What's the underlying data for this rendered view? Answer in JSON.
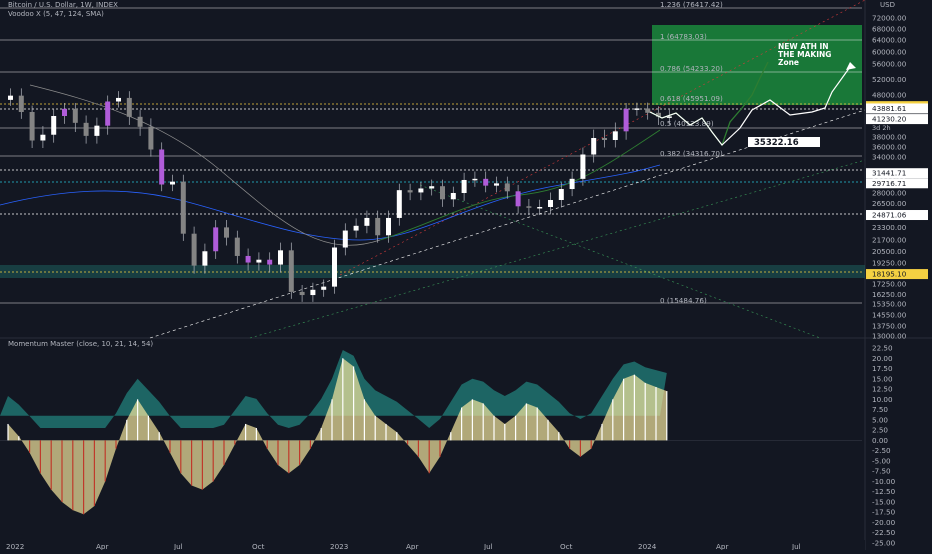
{
  "header": {
    "symbol_title": "Bitcoin / U.S. Dollar, 1W, INDEX",
    "indicator_1": "Voodoo X (5, 47, 124, SMA)",
    "indicator_2": "Momentum Master (close, 10, 21, 14, 54)",
    "currency": "USD"
  },
  "colors": {
    "background": "#131722",
    "up_candle": "#ffffff",
    "down_candle": "#848484",
    "accent_purple": "#b05cd9",
    "fib_box_green": "#1b8a3c",
    "support_band_teal": "#1e8f8a",
    "momentum_green": "#26a69a",
    "momentum_red": "#9b3b3b",
    "wave_yellow": "#f5e79e"
  },
  "chart_data": [
    {
      "type": "candlestick",
      "title": "Bitcoin / U.S. Dollar, 1W, INDEX",
      "x_tick_labels": [
        "2022",
        "Apr",
        "Jul",
        "Oct",
        "2023",
        "Apr",
        "Jul",
        "Oct",
        "2024",
        "Apr",
        "Jul"
      ],
      "y_tick_labels": [
        "72000.00",
        "68000.00",
        "64000.00",
        "60000.00",
        "56000.00",
        "52000.00",
        "48000.00",
        "44000.00",
        "41000.00",
        "38000.00",
        "36000.00",
        "34000.00",
        "31000.00",
        "28000.00",
        "26500.00",
        "25000.00",
        "23300.00",
        "21700.00",
        "20500.00",
        "19250.00",
        "17250.00",
        "15350.00",
        "16250.00",
        "14550.00",
        "13750.00",
        "13000.00"
      ],
      "series": [
        {
          "values": [
            47800,
            43000,
            37300,
            38400,
            42000,
            43800,
            40500,
            38200,
            40000,
            46000,
            47100,
            41800,
            39800,
            35500,
            29500,
            30000,
            22500,
            19000,
            20500,
            23300,
            22000,
            20000,
            19300,
            19600,
            19100,
            20600,
            16500,
            16200,
            16700,
            17000,
            20900,
            22900,
            23500,
            24500,
            22300,
            24500,
            28500,
            28100,
            28800,
            29200,
            27100,
            28000,
            30300,
            30500,
            29300,
            29700,
            28300,
            26100,
            25900,
            26000,
            27000,
            28700,
            30500,
            34500,
            37800,
            37400,
            39000,
            43800,
            43900,
            42800,
            41800,
            41900
          ],
          "color_up": "#ffffff",
          "color_down": "#848484"
        }
      ],
      "fibonacci_levels": [
        {
          "ratio": "1.236",
          "label": "1.236 (76417.42)",
          "value": 76417.42
        },
        {
          "ratio": "1",
          "label": "1 (64783.03)",
          "value": 64783.03
        },
        {
          "ratio": "0.786",
          "label": "0.786 (54233.20)",
          "value": 54233.2
        },
        {
          "ratio": "0.618",
          "label": "0.618 (45951.09)",
          "value": 45951.09
        },
        {
          "ratio": "0.5",
          "label": "0.5 (40123.89)",
          "value": 40123.89
        },
        {
          "ratio": "0.382",
          "label": "0.382 (34316.70)",
          "value": 34316.7
        },
        {
          "ratio": "0",
          "label": "0 (15484.76)",
          "value": 15484.76
        }
      ],
      "price_badges": [
        {
          "label": "44568.51",
          "value": 44568.51,
          "color": "#f5d142",
          "text_color": "#131722"
        },
        {
          "label": "43881.61",
          "value": 43881.61,
          "color": "#ffffff",
          "text_color": "#131722"
        },
        {
          "label": "41230.20",
          "value": 41230.2,
          "color": "#ffffff",
          "text_color": "#131722",
          "sub": "3d 2h"
        },
        {
          "label": "31441.71",
          "value": 31441.71,
          "color": "#ffffff",
          "text_color": "#131722"
        },
        {
          "label": "29716.71",
          "value": 29716.71,
          "color": "#ffffff",
          "text_color": "#131722"
        },
        {
          "label": "24871.06",
          "value": 24871.06,
          "color": "#ffffff",
          "text_color": "#131722"
        },
        {
          "label": "18195.10",
          "value": 18195.1,
          "color": "#f5d142",
          "text_color": "#131722"
        }
      ],
      "annotations": {
        "target_price": "35322.16",
        "ath_text": [
          "NEW ATH IN",
          "THE MAKING",
          "Zone"
        ]
      }
    },
    {
      "type": "area",
      "title": "Momentum Master (close, 10, 21, 14, 54)",
      "y_tick_labels": [
        "22.50",
        "20.00",
        "17.50",
        "15.00",
        "12.50",
        "10.00",
        "7.50",
        "5.00",
        "2.50",
        "0.00",
        "-2.50",
        "-5.00",
        "-7.50",
        "-10.00",
        "-12.50",
        "-15.00",
        "-17.50",
        "-20.00",
        "-22.50",
        "-25.00"
      ],
      "ylim": [
        -25,
        22.5
      ],
      "series": [
        {
          "name": "",
          "values": [
            4,
            1,
            -3,
            -8,
            -12,
            -15,
            -17,
            -18,
            -16,
            -10,
            -2,
            5,
            10,
            6,
            2,
            -3,
            -8,
            -11,
            -12,
            -10,
            -6,
            -1,
            4,
            3,
            -2,
            -6,
            -8,
            -6,
            -2,
            3,
            10,
            20,
            18,
            10,
            6,
            4,
            2,
            -1,
            -4,
            -8,
            -4,
            2,
            8,
            10,
            9,
            6,
            4,
            6,
            9,
            8,
            5,
            2,
            -2,
            -4,
            -2,
            4,
            10,
            15,
            16,
            14,
            13,
            12
          ]
        }
      ]
    }
  ]
}
